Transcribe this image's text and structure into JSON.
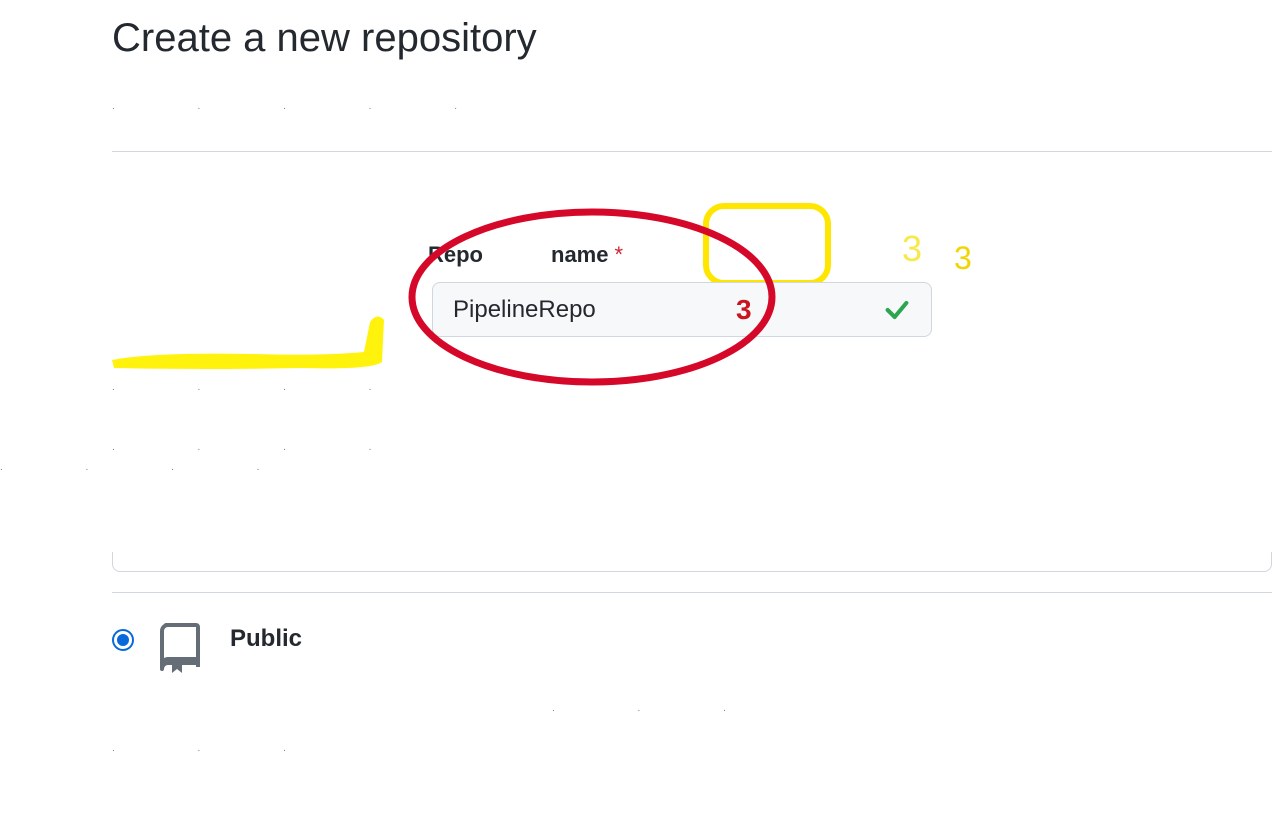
{
  "page": {
    "title": "Create a new repository"
  },
  "form": {
    "repo_name": {
      "label_part1": "Repo",
      "label_part2": "name",
      "required_marker": "*",
      "value": "PipelineRepo"
    },
    "visibility": {
      "public_label": "Public",
      "selected": "public"
    }
  },
  "annotations": {
    "red_number": "3",
    "yellow_number_a": "3",
    "yellow_number_b": "3"
  }
}
